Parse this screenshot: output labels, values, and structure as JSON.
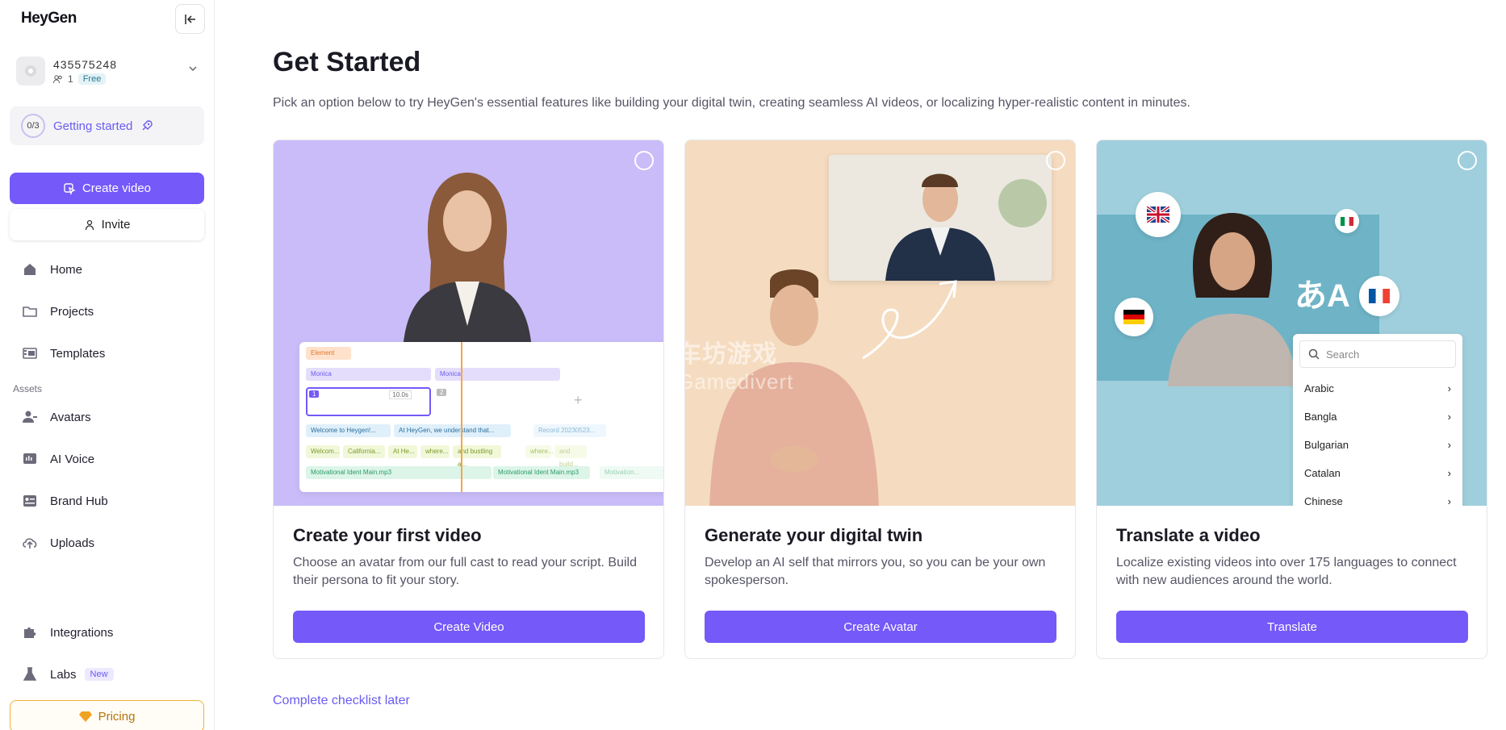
{
  "sidebar": {
    "logo": "HeyGen",
    "account": {
      "name": "435575248",
      "members": "1",
      "plan": "Free"
    },
    "getting_started": {
      "progress": "0/3",
      "label": "Getting started"
    },
    "create_video_label": "Create video",
    "invite_label": "Invite",
    "nav": {
      "home": "Home",
      "projects": "Projects",
      "templates": "Templates",
      "assets_section": "Assets",
      "avatars": "Avatars",
      "ai_voice": "AI Voice",
      "brand_hub": "Brand Hub",
      "uploads": "Uploads",
      "integrations": "Integrations",
      "labs": "Labs",
      "labs_badge": "New"
    },
    "pricing_label": "Pricing"
  },
  "main": {
    "title": "Get Started",
    "subtitle": "Pick an option below to try HeyGen's essential features like building your digital twin, creating seamless AI videos, or localizing hyper-realistic content in minutes.",
    "cards": [
      {
        "title": "Create your first video",
        "desc": "Choose an avatar from our full cast to read your script. Build their persona to fit your story.",
        "button": "Create Video",
        "bg": "#c9bcf8"
      },
      {
        "title": "Generate your digital twin",
        "desc": "Develop an AI self that mirrors you, so you can be your own spokesperson.",
        "button": "Create Avatar",
        "bg": "#f5dcc0"
      },
      {
        "title": "Translate a video",
        "desc": "Localize existing videos into over 175 languages to connect with new audiences around the world.",
        "button": "Translate",
        "bg": "#9fcfdc"
      }
    ],
    "complete_later": "Complete checklist later"
  },
  "timeline_preview": {
    "element_chip": "Element",
    "avatar_chip_a": "Monica",
    "avatar_chip_b": "Monica",
    "scene_badge_1": "1",
    "scene_badge_2": "2",
    "duration": "10.0s",
    "script_a": "Welcome to Heygen!...",
    "script_b": "At HeyGen, we understand that...",
    "record": "Record 20230523...",
    "row2_a": "Welcom...",
    "row2_b": "California...",
    "row2_c": "At He...",
    "row2_d": "where...",
    "row2_e": "and bustling a...",
    "row2_f": "where...",
    "row2_g": "and build...",
    "audio_a": "Motivational Ident Main.mp3",
    "audio_b": "Motivational Ident Main.mp3",
    "audio_c": "Motivation..."
  },
  "translate_preview": {
    "search_placeholder": "Search",
    "languages": [
      "Arabic",
      "Bangla",
      "Bulgarian",
      "Catalan",
      "Chinese"
    ],
    "translate_glyph": "あA"
  },
  "watermark": {
    "cn": "车坊游戏",
    "en": "Gamedivert"
  },
  "colors": {
    "accent": "#7559f9",
    "accent_text": "#6a5cf0",
    "pricing": "#f0b13b"
  }
}
